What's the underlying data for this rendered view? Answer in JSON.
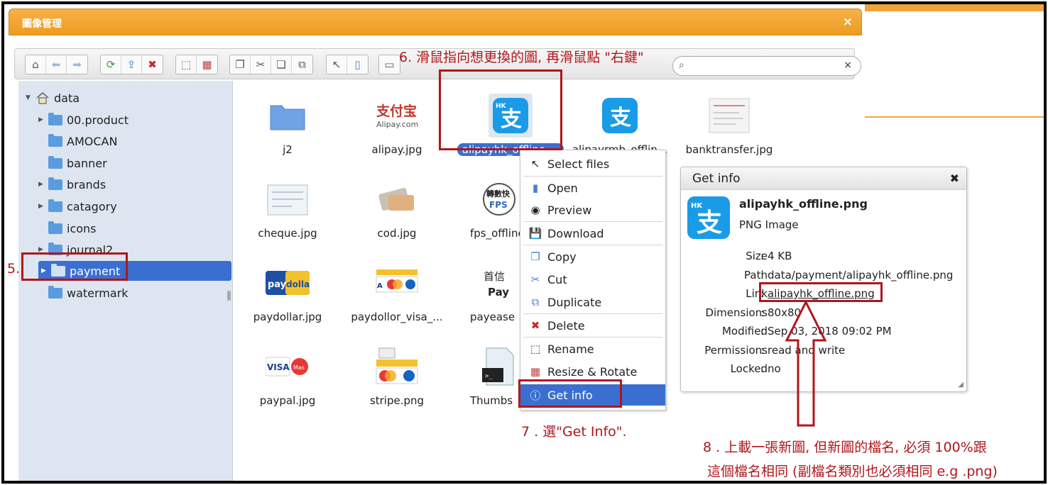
{
  "window": {
    "title": "圖像管理",
    "close_label": "×"
  },
  "search": {
    "value": "",
    "placeholder": "",
    "icon": "search-icon",
    "clear_label": "×"
  },
  "tree": {
    "root": "data",
    "items": [
      {
        "label": "00.product",
        "expandable": true
      },
      {
        "label": "AMOCAN",
        "expandable": false
      },
      {
        "label": "banner",
        "expandable": false
      },
      {
        "label": "brands",
        "expandable": true
      },
      {
        "label": "catagory",
        "expandable": true
      },
      {
        "label": "icons",
        "expandable": false
      },
      {
        "label": "journal2",
        "expandable": true
      },
      {
        "label": "payment",
        "expandable": true,
        "selected": true
      },
      {
        "label": "watermark",
        "expandable": false
      }
    ]
  },
  "files": [
    {
      "name": "j2",
      "kind": "folder"
    },
    {
      "name": "alipay.jpg",
      "kind": "alipay-logo"
    },
    {
      "name": "alipayhk_offline....",
      "kind": "alipayhk",
      "selected": true
    },
    {
      "name": "alipayrmb_offlin...",
      "kind": "alipayrmb"
    },
    {
      "name": "banktransfer.jpg",
      "kind": "document"
    },
    {
      "name": "cheque.jpg",
      "kind": "cheque"
    },
    {
      "name": "cod.jpg",
      "kind": "cash"
    },
    {
      "name": "fps_offline",
      "kind": "fps"
    },
    {
      "name": "paydollar.jpg",
      "kind": "paydollar"
    },
    {
      "name": "paydollor_visa_...",
      "kind": "cards"
    },
    {
      "name": "payease",
      "kind": "payease"
    },
    {
      "name": "paypal.jpg",
      "kind": "visa-master"
    },
    {
      "name": "stripe.png",
      "kind": "stripe"
    },
    {
      "name": "Thumbs",
      "kind": "thumbs"
    }
  ],
  "context_menu": {
    "items": [
      {
        "label": "Select files",
        "icon": "cursor-icon"
      },
      {
        "label": "Open",
        "icon": "open-icon"
      },
      {
        "label": "Preview",
        "icon": "eye-icon"
      },
      {
        "label": "Download",
        "icon": "download-icon"
      },
      {
        "label": "Copy",
        "icon": "copy-icon"
      },
      {
        "label": "Cut",
        "icon": "scissors-icon"
      },
      {
        "label": "Duplicate",
        "icon": "duplicate-icon"
      },
      {
        "label": "Delete",
        "icon": "delete-icon"
      },
      {
        "label": "Rename",
        "icon": "rename-icon"
      },
      {
        "label": "Resize & Rotate",
        "icon": "resize-icon"
      },
      {
        "label": "Get info",
        "icon": "info-icon",
        "active": true
      }
    ]
  },
  "info_panel": {
    "title": "Get info",
    "close_label": "✖",
    "file_name": "alipayhk_offline.png",
    "file_type": "PNG Image",
    "rows": [
      {
        "key": "Size",
        "value": "4 KB"
      },
      {
        "key": "Path",
        "value": "data/payment/alipayhk_offline.png"
      },
      {
        "key": "Link",
        "value": "alipayhk_offline.png"
      },
      {
        "key": "Dimensions",
        "value": "80x80"
      },
      {
        "key": "Modified",
        "value": "Sep 03, 2018 09:02 PM"
      },
      {
        "key": "Permissions",
        "value": "read and write"
      },
      {
        "key": "Locked",
        "value": "no"
      }
    ]
  },
  "annotations": {
    "step5": "5.",
    "step6": "6. 滑鼠指向想更換的圖, 再滑鼠點 \"右鍵\"",
    "step7": "7 . 選\"Get Info\".",
    "step8a": "8 . 上載一張新圖, 但新圖的檔名, 必須 100%跟",
    "step8b": "這個檔名相同 (副檔名類別也必須相同 e.g .png)"
  },
  "colors": {
    "title_bar": "#ee9a20",
    "selection": "#3a6fd0",
    "annotation": "#b0161c",
    "sidebar_bg": "#dde6f0",
    "alipay_blue": "#1a9be8"
  }
}
